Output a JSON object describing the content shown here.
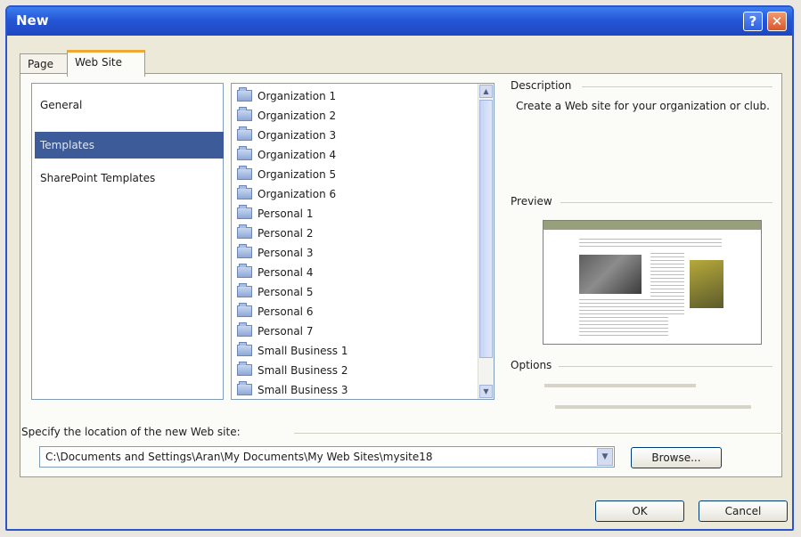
{
  "window": {
    "title": "New",
    "help_symbol": "?",
    "close_symbol": "✕"
  },
  "tabs": [
    {
      "label": "Page"
    },
    {
      "label": "Web Site"
    }
  ],
  "categories": [
    {
      "label": "General"
    },
    {
      "label": "Templates"
    },
    {
      "label": "SharePoint Templates"
    }
  ],
  "templates": [
    {
      "label": "Organization 1"
    },
    {
      "label": "Organization 2"
    },
    {
      "label": "Organization 3"
    },
    {
      "label": "Organization 4"
    },
    {
      "label": "Organization 5"
    },
    {
      "label": "Organization 6"
    },
    {
      "label": "Personal 1"
    },
    {
      "label": "Personal 2"
    },
    {
      "label": "Personal 3"
    },
    {
      "label": "Personal 4"
    },
    {
      "label": "Personal 5"
    },
    {
      "label": "Personal 6"
    },
    {
      "label": "Personal 7"
    },
    {
      "label": "Small Business 1"
    },
    {
      "label": "Small Business 2"
    },
    {
      "label": "Small Business 3"
    }
  ],
  "description": {
    "label": "Description",
    "text": "Create a Web site for your organization or club."
  },
  "preview": {
    "label": "Preview"
  },
  "options": {
    "label": "Options"
  },
  "location": {
    "label": "Specify the location of the new Web site:",
    "value": "C:\\Documents and Settings\\Aran\\My Documents\\My Web Sites\\mysite18"
  },
  "buttons": {
    "browse": "Browse...",
    "ok": "OK",
    "cancel": "Cancel"
  }
}
